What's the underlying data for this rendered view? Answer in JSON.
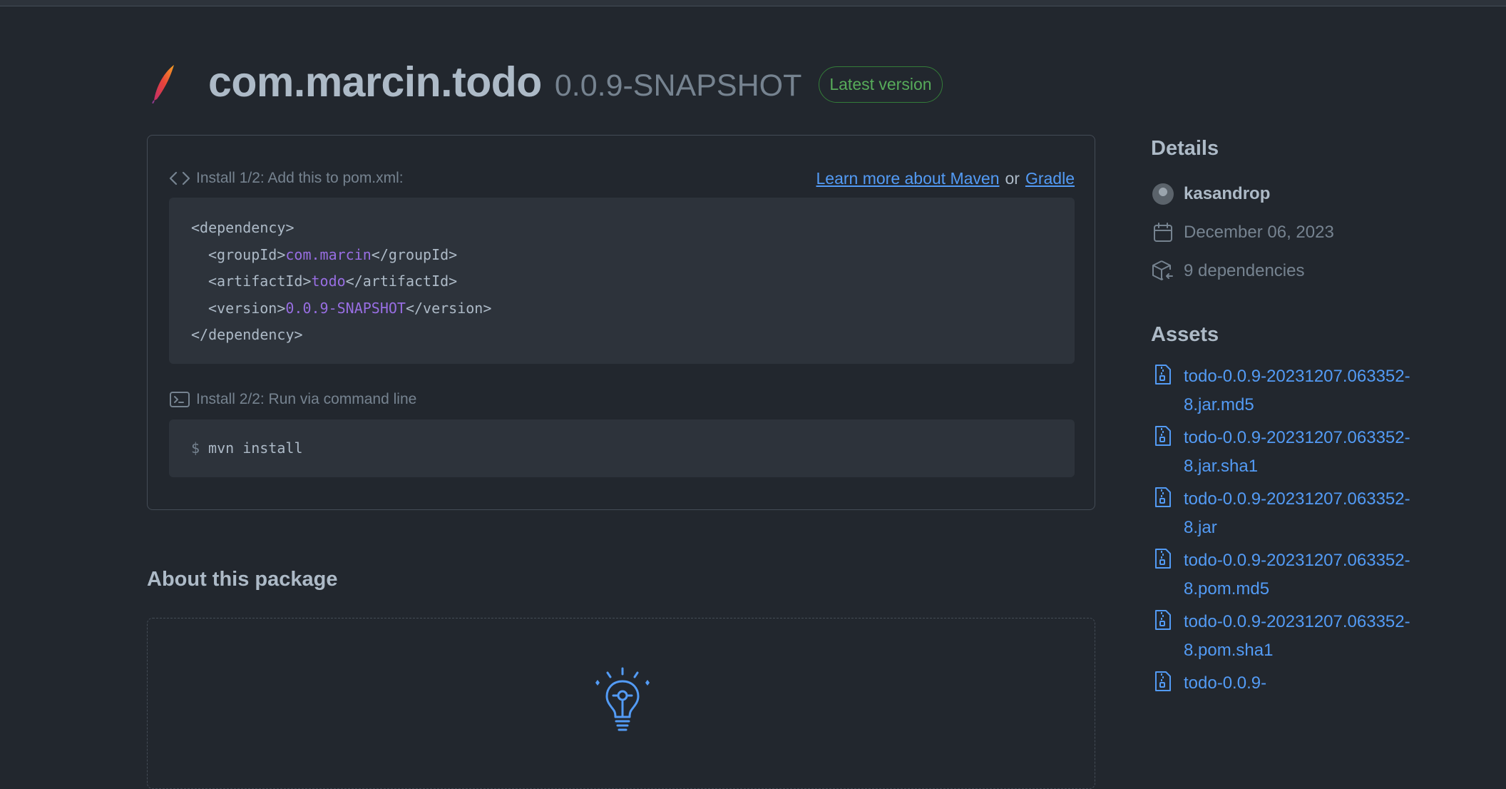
{
  "package": {
    "name": "com.marcin.todo",
    "version": "0.0.9-SNAPSHOT",
    "badge": "Latest version"
  },
  "install": {
    "step1_label": "Install 1/2: Add this to pom.xml:",
    "learn_maven": "Learn more about Maven",
    "or": "or",
    "gradle": "Gradle",
    "xml": {
      "dep_open": "<dependency>",
      "group_open": "<groupId>",
      "group_value": "com.marcin",
      "group_close": "</groupId>",
      "artifact_open": "<artifactId>",
      "artifact_value": "todo",
      "artifact_close": "</artifactId>",
      "version_open": "<version>",
      "version_value": "0.0.9-SNAPSHOT",
      "version_close": "</version>",
      "dep_close": "</dependency>"
    },
    "step2_label": "Install 2/2: Run via command line",
    "prompt": "$",
    "command": "mvn install"
  },
  "about": {
    "title": "About this package"
  },
  "details": {
    "title": "Details",
    "author": "kasandrop",
    "date": "December 06, 2023",
    "dependencies": "9 dependencies"
  },
  "assets": {
    "title": "Assets",
    "items": [
      "todo-0.0.9-20231207.063352-8.jar.md5",
      "todo-0.0.9-20231207.063352-8.jar.sha1",
      "todo-0.0.9-20231207.063352-8.jar",
      "todo-0.0.9-20231207.063352-8.pom.md5",
      "todo-0.0.9-20231207.063352-8.pom.sha1",
      "todo-0.0.9-"
    ]
  },
  "colors": {
    "background": "#22272e",
    "accent_link": "#539bf5",
    "badge_green": "#57ab5a",
    "code_purple": "#986ee2"
  }
}
